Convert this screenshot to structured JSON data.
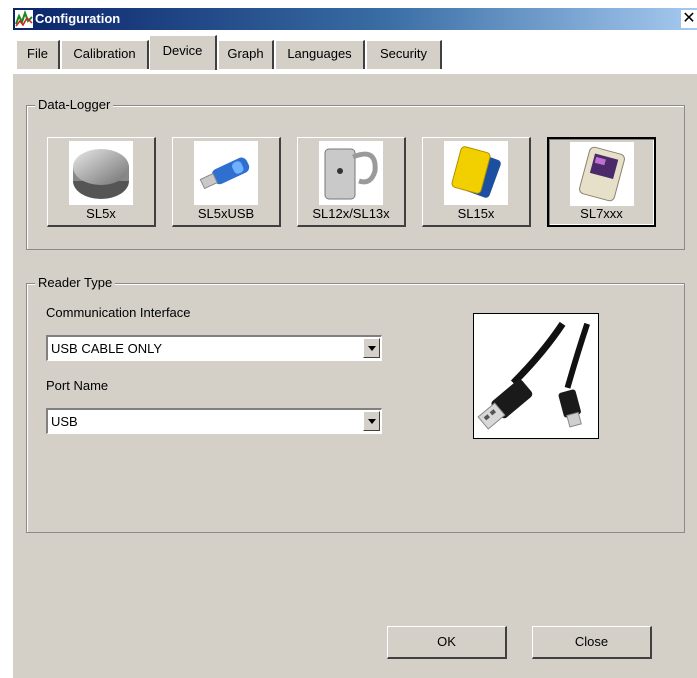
{
  "window": {
    "title": "Configuration",
    "close_glyph": "✕"
  },
  "tabs": [
    {
      "label": "File",
      "active": false
    },
    {
      "label": "Calibration",
      "active": false
    },
    {
      "label": "Device",
      "active": true
    },
    {
      "label": "Graph",
      "active": false
    },
    {
      "label": "Languages",
      "active": false
    },
    {
      "label": "Security",
      "active": false
    }
  ],
  "data_logger": {
    "title": "Data-Logger",
    "devices": [
      {
        "label": "SL5x",
        "icon": "coin-cell-icon",
        "selected": false
      },
      {
        "label": "SL5xUSB",
        "icon": "usb-stick-icon",
        "selected": false
      },
      {
        "label": "SL12x/SL13x",
        "icon": "clip-logger-icon",
        "selected": false
      },
      {
        "label": "SL15x",
        "icon": "tag-logger-icon",
        "selected": false
      },
      {
        "label": "SL7xxx",
        "icon": "display-logger-icon",
        "selected": true
      }
    ]
  },
  "reader_type": {
    "title": "Reader Type",
    "comm_label": "Communication Interface",
    "comm_value": "USB CABLE ONLY",
    "port_label": "Port Name",
    "port_value": "USB",
    "preview_icon": "usb-cable-icon"
  },
  "buttons": {
    "ok": "OK",
    "close": "Close"
  },
  "colors": {
    "face": "#d4d0c8",
    "title_start": "#0a246a",
    "title_end": "#a6caf0"
  }
}
